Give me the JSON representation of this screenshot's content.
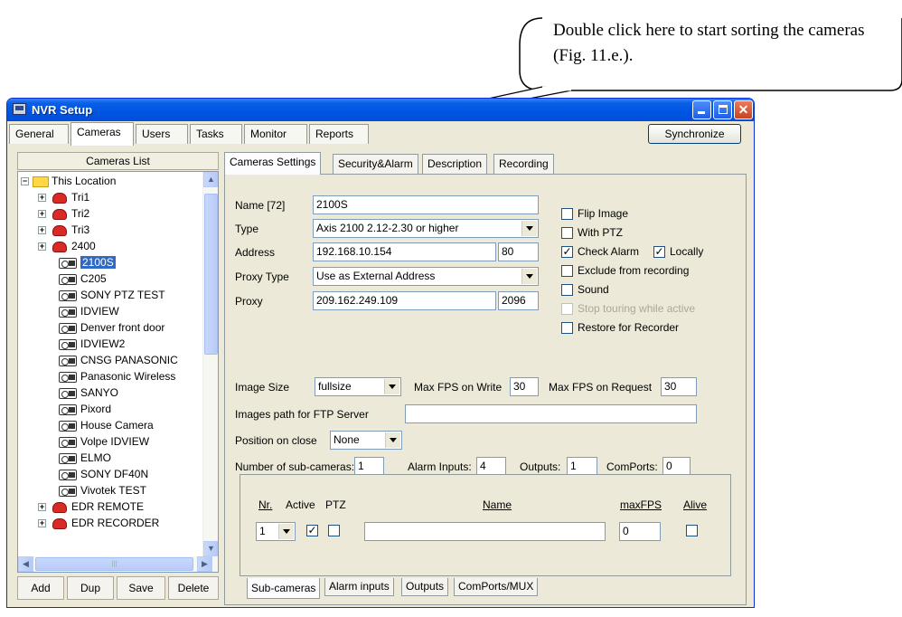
{
  "callout": {
    "text": "Double click here to start sorting the cameras (Fig. 11.e.)."
  },
  "window": {
    "title": "NVR Setup"
  },
  "top_tabs": [
    "General",
    "Cameras",
    "Users",
    "Tasks",
    "Monitor",
    "Reports"
  ],
  "synchronize_label": "Synchronize",
  "camera_list": {
    "header": "Cameras List",
    "root": "This Location",
    "groups_top": [
      "Tri1",
      "Tri2",
      "Tri3",
      "2400"
    ],
    "cameras": [
      "2100S",
      "C205",
      "SONY PTZ TEST",
      "IDVIEW",
      "Denver front door",
      "IDVIEW2",
      "CNSG PANASONIC",
      "Panasonic Wireless",
      "SANYO",
      "Pixord",
      "House Camera",
      "Volpe IDVIEW",
      "ELMO",
      "SONY DF40N",
      "Vivotek TEST"
    ],
    "groups_bottom": [
      "EDR REMOTE",
      "EDR RECORDER"
    ],
    "selected": "2100S",
    "buttons": {
      "add": "Add",
      "dup": "Dup",
      "save": "Save",
      "delete": "Delete"
    }
  },
  "settings_tabs": [
    "Cameras Settings",
    "Security&Alarm",
    "Description",
    "Recording"
  ],
  "settings": {
    "name_label": "Name [72]",
    "name_value": "2100S",
    "type_label": "Type",
    "type_value": "Axis 2100 2.12-2.30 or higher",
    "address_label": "Address",
    "address_value": "192.168.10.154",
    "port_value": "80",
    "proxy_type_label": "Proxy Type",
    "proxy_type_value": "Use as External Address",
    "proxy_label": "Proxy",
    "proxy_value": "209.162.249.109",
    "proxy_port_value": "2096"
  },
  "options": {
    "flip_image": {
      "label": "Flip Image",
      "checked": false
    },
    "with_ptz": {
      "label": "With PTZ",
      "checked": false
    },
    "check_alarm": {
      "label": "Check Alarm",
      "checked": true
    },
    "locally": {
      "label": "Locally",
      "checked": true
    },
    "exclude": {
      "label": "Exclude from recording",
      "checked": false
    },
    "sound": {
      "label": "Sound",
      "checked": false
    },
    "stop_touring": {
      "label": "Stop touring while active",
      "checked": false
    },
    "restore": {
      "label": "Restore for Recorder",
      "checked": false
    }
  },
  "image": {
    "size_label": "Image Size",
    "size_value": "fullsize",
    "max_fps_write_label": "Max FPS on Write",
    "max_fps_write_value": "30",
    "max_fps_request_label": "Max FPS on Request",
    "max_fps_request_value": "30",
    "ftp_label": "Images path for FTP Server",
    "ftp_value": "",
    "position_label": "Position on close",
    "position_value": "None"
  },
  "counts": {
    "subcams_label": "Number of sub-cameras:",
    "subcams_value": "1",
    "alarm_inputs_label": "Alarm Inputs:",
    "alarm_inputs_value": "4",
    "outputs_label": "Outputs:",
    "outputs_value": "1",
    "comports_label": "ComPorts:",
    "comports_value": "0"
  },
  "subcam_table": {
    "headers": {
      "nr": "Nr.",
      "active": "Active",
      "ptz": "PTZ",
      "name": "Name",
      "maxfps": "maxFPS",
      "alive": "Alive"
    },
    "row": {
      "nr": "1",
      "active": true,
      "ptz": false,
      "name": "",
      "maxfps": "0",
      "alive": false
    }
  },
  "bottom_tabs": [
    "Sub-cameras",
    "Alarm inputs",
    "Outputs",
    "ComPorts/MUX"
  ]
}
